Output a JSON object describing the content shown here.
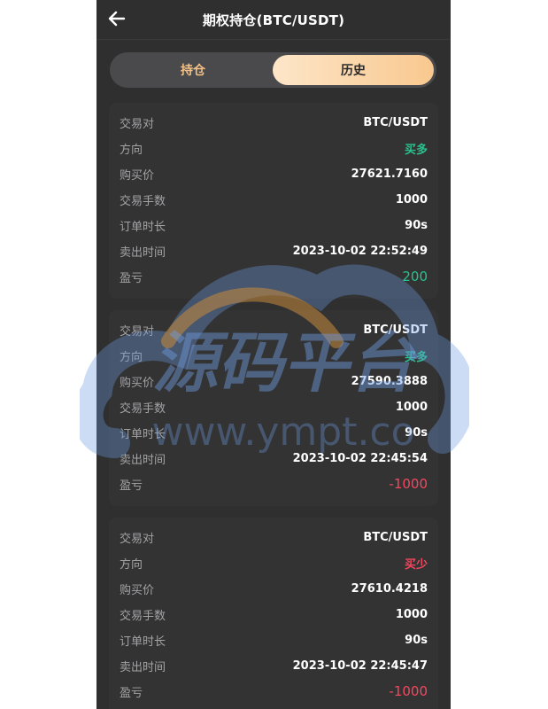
{
  "header": {
    "title": "期权持仓(BTC/USDT)"
  },
  "tabs": [
    {
      "label": "持仓",
      "active": false
    },
    {
      "label": "历史",
      "active": true
    }
  ],
  "labels": {
    "pair": "交易对",
    "direction": "方向",
    "buy_price": "购买价",
    "lots": "交易手数",
    "duration": "订单时长",
    "sell_time": "卖出时间",
    "pnl": "盈亏"
  },
  "orders": [
    {
      "pair": "BTC/USDT",
      "direction": "买多",
      "direction_color": "#2bc18e",
      "buy_price": "27621.7160",
      "lots": "1000",
      "duration": "90s",
      "sell_time": "2023-10-02 22:52:49",
      "pnl": "200",
      "pnl_color": "#2bc18e"
    },
    {
      "pair": "BTC/USDT",
      "direction": "买多",
      "direction_color": "#2bc18e",
      "buy_price": "27590.3888",
      "lots": "1000",
      "duration": "90s",
      "sell_time": "2023-10-02 22:45:54",
      "pnl": "-1000",
      "pnl_color": "#f3485f"
    },
    {
      "pair": "BTC/USDT",
      "direction": "买少",
      "direction_color": "#f3485f",
      "buy_price": "27610.4218",
      "lots": "1000",
      "duration": "90s",
      "sell_time": "2023-10-02 22:45:47",
      "pnl": "-1000",
      "pnl_color": "#f3485f"
    }
  ],
  "watermark": {
    "title": "源码平台",
    "url": "www.ympt.co"
  },
  "colors": {
    "background": "#2f2f30",
    "card": "#333334",
    "accent": "#f9c88f",
    "profit": "#2bc18e",
    "loss": "#f3485f"
  }
}
